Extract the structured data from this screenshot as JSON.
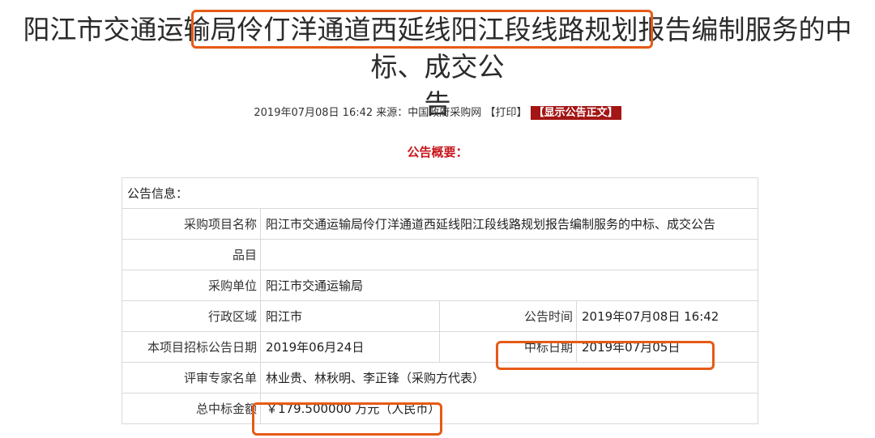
{
  "title_line1": "阳江市交通运输局伶仃洋通道西延线阳江段线路规划报告编制服务的中标、成交公",
  "title_line2": "告",
  "meta": {
    "date": "2019年07月08日 16:42",
    "source": "来源：中国政府采购网",
    "print": "【打印】",
    "show_text": "【显示公告正文】"
  },
  "summary_title": "公告概要：",
  "table": {
    "section_header": "公告信息：",
    "project_name_label": "采购项目名称",
    "project_name_value": "阳江市交通运输局伶仃洋通道西延线阳江段线路规划报告编制服务的中标、成交公告",
    "item_label": "品目",
    "item_value": "",
    "purchaser_label": "采购单位",
    "purchaser_value": "阳江市交通运输局",
    "region_label": "行政区域",
    "region_value": "阳江市",
    "pub_time_label": "公告时间",
    "pub_time_value": "2019年07月08日 16:42",
    "tender_date_label": "本项目招标公告日期",
    "tender_date_value": "2019年06月24日",
    "award_date_label": "中标日期",
    "award_date_value": "2019年07月05日",
    "experts_label": "评审专家名单",
    "experts_value": "林业贵、林秋明、李正锋（采购方代表）",
    "amount_label": "总中标金额",
    "amount_value": "￥179.500000 万元（人民币）"
  },
  "highlight_color": "#e65a16"
}
